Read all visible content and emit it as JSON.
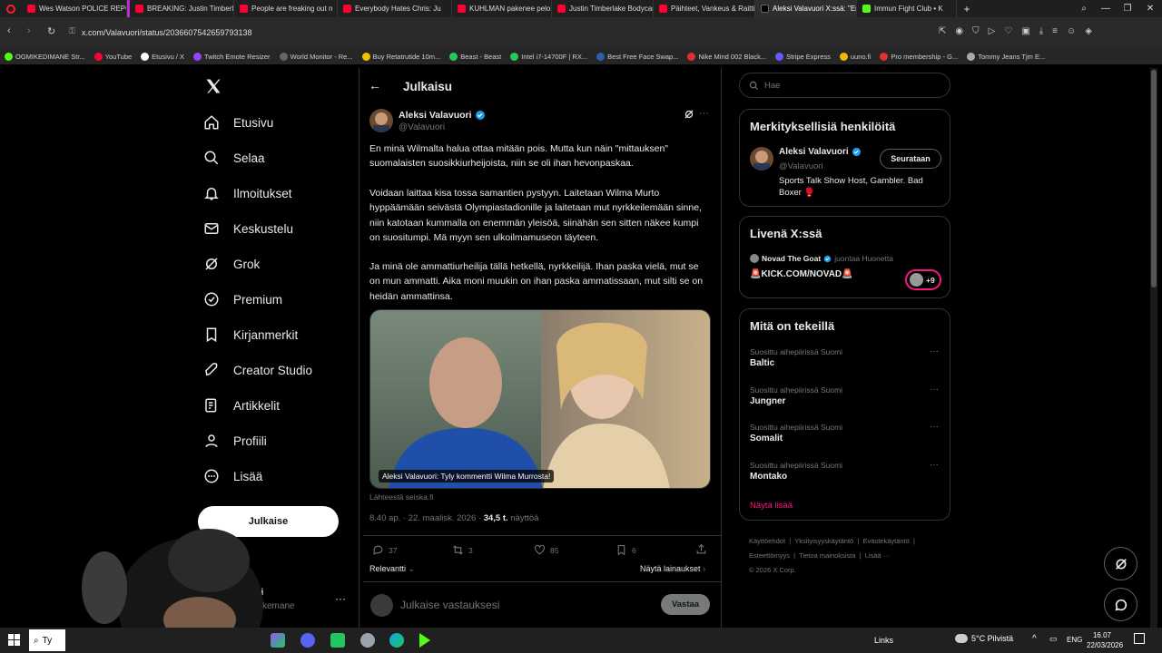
{
  "browser": {
    "tabs": [
      "Wes Watson POLICE REPO",
      "BREAKING: Justin Timberl",
      "People are freaking out n",
      "Everybody Hates Chris: Ju",
      "KUHLMAN pakenee pelon",
      "Justin Timberlake Bodycar",
      "Päihteet, Vankeus & Raitti",
      "Aleksi Valavuori X:ssä: \"En",
      "Immun Fight Club • K"
    ],
    "url": "x.com/Valavuori/status/2036607542659793138",
    "bookmarks": [
      "OGMIKEDIMANE Str...",
      "YouTube",
      "Etusivu / X",
      "Twitch Emote Resizer",
      "World Monitor - Re...",
      "Buy Retatrutide 10m...",
      "Beast - Beast",
      "Intel i7-14700F | RX...",
      "Best Free Face Swap...",
      "Nike Mind 002 Black...",
      "Stripe Express",
      "uuno.fi",
      "Pro membership - G...",
      "Tommy Jeans Tjm E..."
    ]
  },
  "nav": {
    "items": [
      "Etusivu",
      "Selaa",
      "Ilmoitukset",
      "Keskustelu",
      "Grok",
      "Premium",
      "Kirjanmerkit",
      "Creator Studio",
      "Artikkelit",
      "Profiili",
      "Lisää"
    ],
    "post_button": "Julkaise",
    "account_name": "redi",
    "account_handle": "kkemane"
  },
  "post": {
    "header_title": "Julkaisu",
    "author_name": "Aleksi Valavuori",
    "author_handle": "@Valavuori",
    "paragraphs": [
      "En minä Wilmalta halua ottaa mitään pois. Mutta kun näin \"mittauksen\" suomalaisten suosikkiurheijoista, niin se oli ihan hevonpaskaa.",
      "Voidaan laittaa kisa tossa samantien pystyyn. Laitetaan Wilma Murto hyppäämään seivästä Olympiastadionille ja laitetaan mut nyrkkeilemään sinne, niin katotaan kummalla on enemmän yleisöä, siinähän sen sitten näkee kumpi on suositumpi. Mä myyn sen ulkoilmamuseon täyteen.",
      "Ja minä ole ammattiurheilija tällä hetkellä, nyrkkeilijä. Ihan paska vielä, mut se on mun ammatti. Aika moni muukin on ihan paska ammatissaan, mut silti se on heidän ammattinsa."
    ],
    "image_caption": "Aleksi Valavuori: Tyly kommentti Wilma Murrosta!",
    "source": "Lähteestä seiska.fi",
    "time": "8.40 ap. · 22. maalisk. 2026 · ",
    "views_count": "34,5 t.",
    "views_label": " näyttöä",
    "replies": "37",
    "reposts": "3",
    "likes": "85",
    "bookmarks": "6",
    "sort_label": "Relevantti",
    "quotes_label": "Näytä lainaukset",
    "reply_placeholder": "Julkaise vastauksesi",
    "reply_button": "Vastaa"
  },
  "sidebar": {
    "search_placeholder": "Hae",
    "relevant_title": "Merkityksellisiä henkilöitä",
    "relevant_name": "Aleksi Valavuori",
    "relevant_handle": "@Valavuori",
    "follow_label": "Seurataan",
    "relevant_bio": "Sports Talk Show Host, Gambler. Bad Boxer 🥊",
    "live_title": "Livenä X:ssä",
    "live_host": "Novad The Goat",
    "live_suffix": "juontaa Huonetta",
    "live_room": "🚨KICK.COM/NOVAD🚨",
    "live_count": "+9",
    "trends_title": "Mitä on tekeillä",
    "trends": [
      {
        "category": "Suosittu aihepiirissä Suomi",
        "name": "Baltic"
      },
      {
        "category": "Suosittu aihepiirissä Suomi",
        "name": "Jungner"
      },
      {
        "category": "Suosittu aihepiirissä Suomi",
        "name": "Somalit"
      },
      {
        "category": "Suosittu aihepiirissä Suomi",
        "name": "Montako"
      }
    ],
    "show_more": "Näytä lisää",
    "footer_links": [
      "Käyttöehdot",
      "Yksityisyyskäytäntö",
      "Evästekäytäntö",
      "Esteettömyys",
      "Tietoa mainoksista",
      "Lisää ···"
    ],
    "copyright": "© 2026 X Corp."
  },
  "taskbar": {
    "search": "Ty",
    "links": "Links",
    "weather": "5°C Pilvistä",
    "lang": "ENG",
    "time": "16.07",
    "date": "22/03/2026"
  },
  "colors": {
    "accent": "#1d9bf0",
    "background": "#000000",
    "pink": "#f91880",
    "live_ring": "#f91880"
  }
}
